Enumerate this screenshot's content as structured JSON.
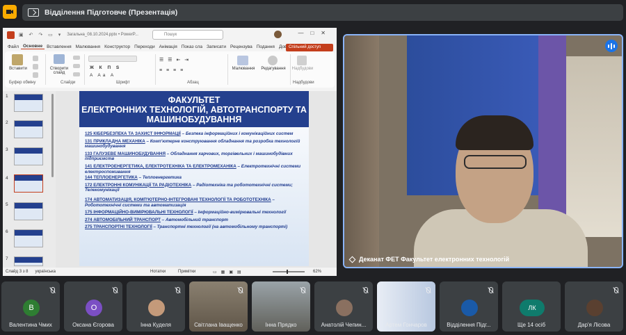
{
  "meeting": {
    "presenting_label": "Відділення Підготовче (Презентація)"
  },
  "ppt": {
    "doc_name": "Загальна_08.10.2024.pptx • PowerP...",
    "search_placeholder": "Пошук",
    "tabs": [
      "Файл",
      "Основне",
      "Вставлення",
      "Малювання",
      "Конструктор",
      "Переходи",
      "Анімація",
      "Показ сла",
      "Записати",
      "Рецензува",
      "Подання",
      "Довідка"
    ],
    "share_label": "Спільний доступ",
    "ribbon": {
      "paste": "Вставити",
      "create_slide": "Створити слайд",
      "clipboard": "Буфер обміну",
      "slides": "Слайди",
      "font": "Шрифт",
      "paragraph": "Абзац",
      "drawing": "Малювання",
      "editing": "Редагування",
      "addins_btn": "Надбудови",
      "addins": "Надбудови"
    },
    "thumb_numbers": [
      "1",
      "2",
      "3",
      "4",
      "5",
      "6",
      "7"
    ],
    "slide": {
      "title_line1": "ФАКУЛЬТЕТ",
      "title_line2": "ЕЛЕКТРОННИХ ТЕХНОЛОГІЙ, АВТОТРАНСПОРТУ ТА",
      "title_line3": "МАШИНОБУДУВАННЯ",
      "items": [
        {
          "code": "125 КІБЕРБЕЗПЕКА ТА ЗАХИСТ ІНФОРМАЦІЇ",
          "desc": " – Безпека інформаційних і комунікаційних систем"
        },
        {
          "code": "131 ПРИКЛАДНА МЕХАНІКА",
          "desc": " – Комп'ютерне конструювання обладнання та розробка технологій машинобудування"
        },
        {
          "code": "133 ГАЛУЗЕВЕ МАШИНОБУДУВАННЯ",
          "desc": " – Обладнання харчових, торгівельних і машинобудівних підприємств"
        },
        {
          "code": "141 ЕЛЕКТРОЕНЕРГЕТИКА, ЕЛЕКТРОТЕХНІКА ТА ЕЛЕКТРОМЕХАНІКА",
          "desc": " – Електротехнічні системи електроспоживання"
        },
        {
          "code": "144 ТЕПЛОЕНЕРГЕТИКА",
          "desc": " – Теплоенергетика"
        },
        {
          "code": "172 ЕЛЕКТРОННІ КОМУНІКАЦІЇ ТА РАДІОТЕХНІКА",
          "desc": " – Радіотехніка та робототехнічні системи; Телекомунікації"
        },
        {
          "code": "174 АВТОМАТИЗАЦІЯ, КОМП'ЮТЕРНО-ІНТЕГРОВАНІ ТЕХНОЛОГІЇ ТА РОБОТОТЕХНІКА",
          "desc": " – Робототехнічні системи та автоматизація"
        },
        {
          "code": "175 ІНФОРМАЦІЙНО-ВИМІРЮВАЛЬНІ ТЕХНОЛОГІЇ",
          "desc": " – Інформаційно-вимірювальні технології"
        },
        {
          "code": "274 АВТОМОБІЛЬНИЙ ТРАНСПОРТ",
          "desc": " – Автомобільний транспорт"
        },
        {
          "code": "275 ТРАНСПОРТНІ ТЕХНОЛОГІЇ",
          "desc": " – Транспортні технології (на автомобільному транспорті)"
        }
      ]
    },
    "status": {
      "slide_info": "Слайд 3 з 8",
      "language": "українська",
      "notes": "Нотатки",
      "comments": "Примітки",
      "zoom": "62%"
    }
  },
  "speaker": {
    "name": "Деканат ФЕТ Факультет електронних технологій"
  },
  "participants": [
    {
      "name": "Валентина Чмих",
      "initial": "В",
      "color": "#2e7d32"
    },
    {
      "name": "Оксана Єгорова",
      "initial": "О",
      "color": "#7b4fc4"
    },
    {
      "name": "Інна Куделя",
      "initial": "",
      "color": "#c49a7a"
    },
    {
      "name": "Світлана Іващенко",
      "initial": "",
      "color": ""
    },
    {
      "name": "Інна Прядко",
      "initial": "",
      "color": ""
    },
    {
      "name": "Анатолій Чепин...",
      "initial": "",
      "color": "#8a7060"
    },
    {
      "name": "Артем Гончаров",
      "initial": "",
      "color": ""
    },
    {
      "name": "Відділення Підг...",
      "initial": "",
      "color": "#1a5aa8"
    },
    {
      "name": "Ще 14 осіб",
      "initial": "ЛК",
      "color": "#0f7b6c"
    },
    {
      "name": "Дар'я Лісова",
      "initial": "",
      "color": "#5a4030"
    }
  ],
  "colors": {
    "accent": "#8ab4f8",
    "ppt_brand": "#c43e1c",
    "slide_header": "#24408e"
  }
}
